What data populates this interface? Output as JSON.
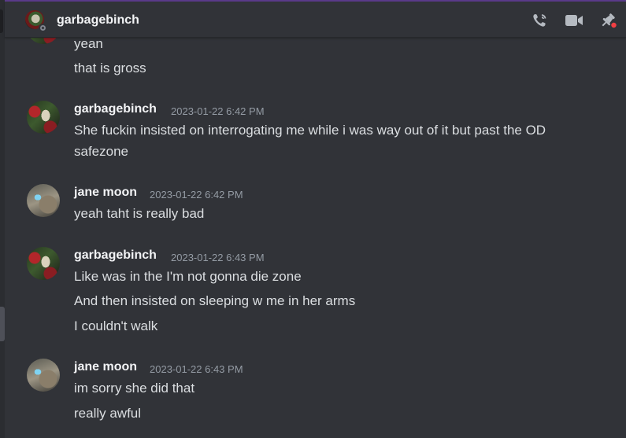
{
  "header": {
    "title": "garbagebinch",
    "icons": [
      "phone-icon",
      "video-icon",
      "pin-icon"
    ],
    "pin_notification_color": "#f23f43"
  },
  "messages": [
    {
      "continued": true,
      "lines": [
        "yean",
        "that is gross"
      ]
    },
    {
      "author": "garbagebinch",
      "timestamp": "2023-01-22 6:42 PM",
      "lines": [
        "She fuckin insisted on interrogating me while i was way out of it but past the OD",
        "safezone"
      ]
    },
    {
      "author": "jane moon",
      "timestamp": "2023-01-22 6:42 PM",
      "lines": [
        "yeah taht is really bad"
      ]
    },
    {
      "author": "garbagebinch",
      "timestamp": "2023-01-22 6:43 PM",
      "lines": [
        "Like was in the I'm not gonna die zone",
        "And then insisted on sleeping w me in her arms",
        "I couldn't walk"
      ]
    },
    {
      "author": "jane moon",
      "timestamp": "2023-01-22 6:43 PM",
      "lines": [
        "im sorry she did that",
        "really awful"
      ]
    }
  ],
  "colors": {
    "background": "#313338",
    "text": "#dbdee1",
    "username": "#f2f3f5",
    "timestamp": "#949ba4",
    "accent_topline": "#5b3a8a"
  }
}
